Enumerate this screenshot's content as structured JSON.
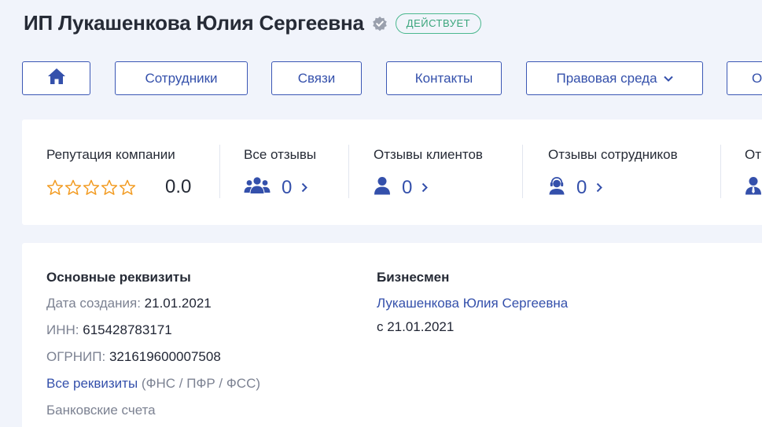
{
  "header": {
    "title": "ИП Лукашенкова Юлия Сергеевна",
    "status": "ДЕЙСТВУЕТ"
  },
  "nav": {
    "home_icon": "home-icon",
    "items": [
      "Сотрудники",
      "Связи",
      "Контакты",
      "Правовая среда",
      "О"
    ]
  },
  "reputation": {
    "company_label": "Репутация компании",
    "rating": "0.0",
    "stars_total": 5,
    "stars_filled": 0,
    "all_label": "Все отзывы",
    "all_count": "0",
    "clients_label": "Отзывы клиентов",
    "clients_count": "0",
    "employees_label": "Отзывы сотрудников",
    "employees_count": "0",
    "extra_label": "От"
  },
  "details": {
    "title": "Основные реквизиты",
    "created_label": "Дата создания:",
    "created_value": "21.01.2021",
    "inn_label": "ИНН:",
    "inn_value": "615428783171",
    "ogrnip_label": "ОГРНИП:",
    "ogrnip_value": "321619600007508",
    "all_link": "Все реквизиты",
    "all_sub": "(ФНС / ПФР / ФСС)",
    "bank_accounts": "Банковские счета"
  },
  "businessman": {
    "title": "Бизнесмен",
    "name": "Лукашенкова Юлия Сергеевна",
    "since": "с 21.01.2021"
  },
  "colors": {
    "accent": "#3450ab",
    "status_green": "#3aa57c",
    "star_orange": "#f29a1f"
  }
}
